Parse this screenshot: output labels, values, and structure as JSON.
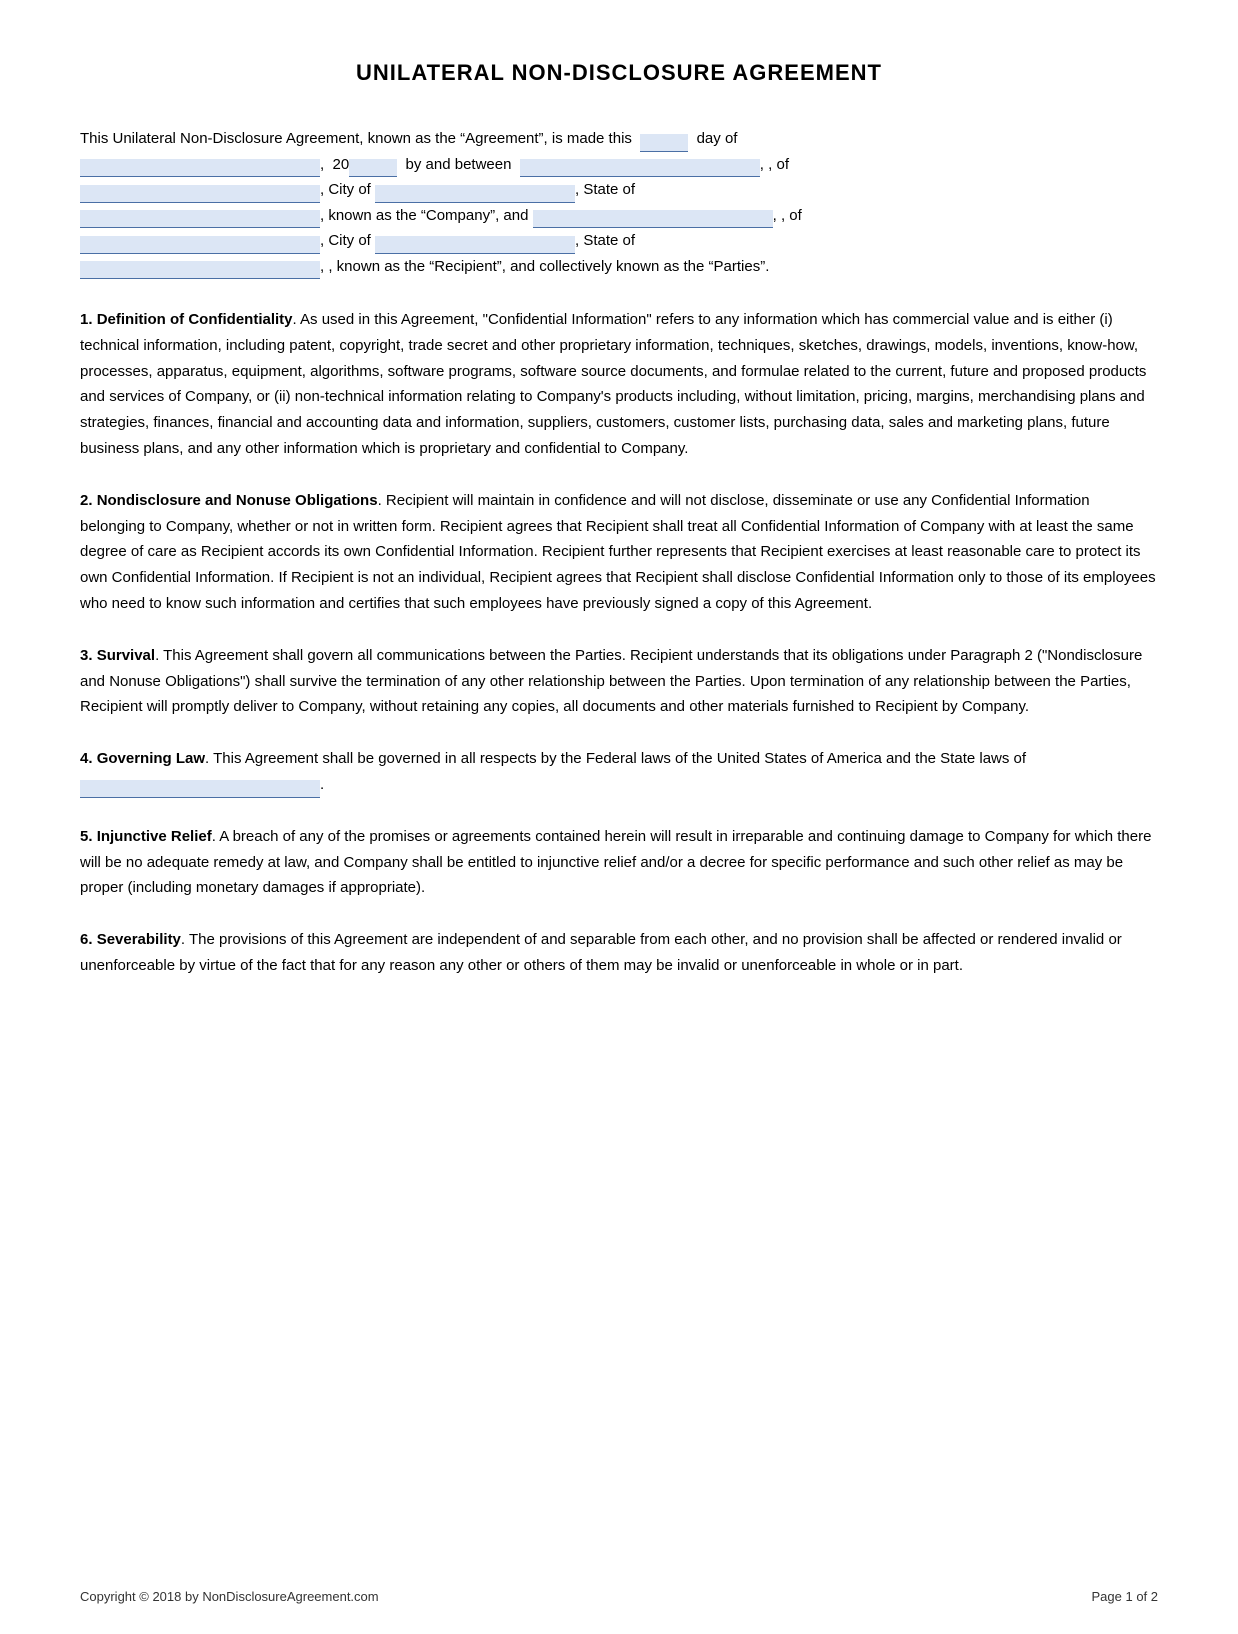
{
  "page": {
    "title": "UNILATERAL NON-DISCLOSURE AGREEMENT",
    "intro": {
      "line1_start": "This Unilateral Non-Disclosure Agreement, known as the “Agreement”, is made this",
      "line1_end": "day of",
      "line2_start": ", 20",
      "line2_mid": "by and between",
      "line2_end": ", of",
      "line3_start": ", City of",
      "line3_end": ", State of",
      "line4_start": ", known as the “Company”, and",
      "line4_end": ", of",
      "line5_start": ", City of",
      "line5_end": ", State of",
      "line6": ", known as the “Recipient”, and collectively known as the “Parties”."
    },
    "sections": [
      {
        "number": "1",
        "title": "Definition of Confidentiality",
        "body": ". As used in this Agreement, \"Confidential Information\" refers to any information which has commercial value and is either (i) technical information, including patent, copyright, trade secret and other proprietary information, techniques, sketches, drawings, models, inventions, know-how, processes, apparatus, equipment, algorithms, software programs, software source documents, and formulae related to the current, future and proposed products and services of Company, or (ii) non-technical information relating to Company's products including, without limitation, pricing, margins, merchandising plans and strategies, finances, financial and accounting data and information, suppliers, customers, customer lists, purchasing data, sales and marketing plans, future business plans, and any other information which is proprietary and confidential to Company."
      },
      {
        "number": "2",
        "title": "Nondisclosure and Nonuse Obligations",
        "body": ". Recipient will maintain in confidence and will not disclose, disseminate or use any Confidential Information belonging to Company, whether or not in written form. Recipient agrees that Recipient shall treat all Confidential Information of Company with at least the same degree of care as Recipient accords its own Confidential Information. Recipient further represents that Recipient exercises at least reasonable care to protect its own Confidential Information. If Recipient is not an individual, Recipient agrees that Recipient shall disclose Confidential Information only to those of its employees who need to know such information and certifies that such employees have previously signed a copy of this Agreement."
      },
      {
        "number": "3",
        "title": "Survival",
        "body": ". This Agreement shall govern all communications between the Parties. Recipient understands that its obligations under Paragraph 2 (\"Nondisclosure and Nonuse Obligations\") shall survive the termination of any other relationship between the Parties. Upon termination of any relationship between the Parties, Recipient will promptly deliver to Company, without retaining any copies, all documents and other materials furnished to Recipient by Company."
      },
      {
        "number": "4",
        "title": "Governing Law",
        "body": ".  This Agreement shall be governed in all respects by the Federal laws of the United States of America and the State laws of"
      },
      {
        "number": "5",
        "title": "Injunctive Relief",
        "body": ".  A breach of any of the promises or agreements contained herein will result in irreparable and continuing damage to Company for which there will be no adequate remedy at law, and Company shall be entitled to injunctive relief and/or a decree for specific performance and such other relief as may be proper (including monetary damages if appropriate)."
      },
      {
        "number": "6",
        "title": "Severability",
        "body": ". The provisions of this Agreement are independent of and separable from each other, and no provision shall be affected or rendered invalid or unenforceable by virtue of the fact that for any reason any other or others of them may be invalid or unenforceable in whole or in part."
      }
    ],
    "footer": {
      "copyright": "Copyright © 2018 by NonDisclosureAgreement.com",
      "page": "Page 1 of 2"
    }
  }
}
